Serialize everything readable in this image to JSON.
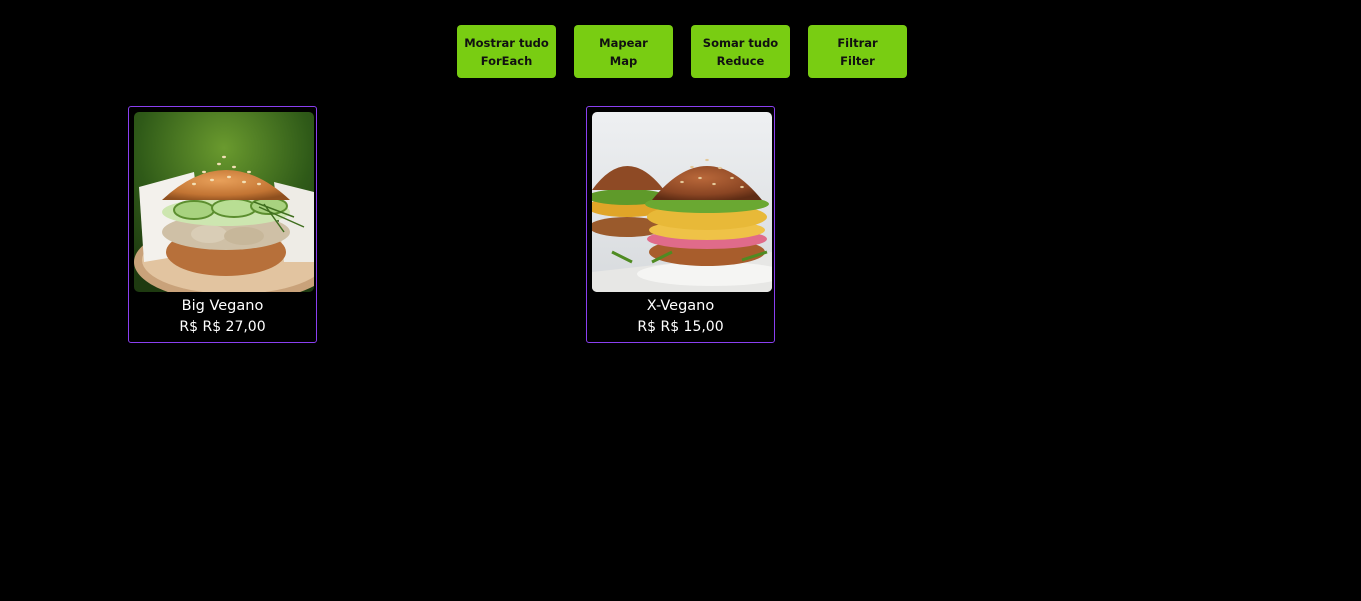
{
  "toolbar": {
    "buttons": [
      {
        "line1": "Mostrar tudo",
        "line2": "ForEach"
      },
      {
        "line1": "Mapear",
        "line2": "Map"
      },
      {
        "line1": "Somar tudo",
        "line2": "Reduce"
      },
      {
        "line1": "Filtrar",
        "line2": "Filter"
      }
    ],
    "button_color": "#79cd12"
  },
  "products": [
    {
      "name": "Big Vegano",
      "price": "R$ R$ 27,00",
      "image": "vegan-burger-cucumber-photo"
    },
    {
      "name": "X-Vegano",
      "price": "R$ R$ 15,00",
      "image": "vegan-burger-patty-photo"
    }
  ],
  "colors": {
    "background": "#000000",
    "card_border": "#8a3ff1"
  }
}
